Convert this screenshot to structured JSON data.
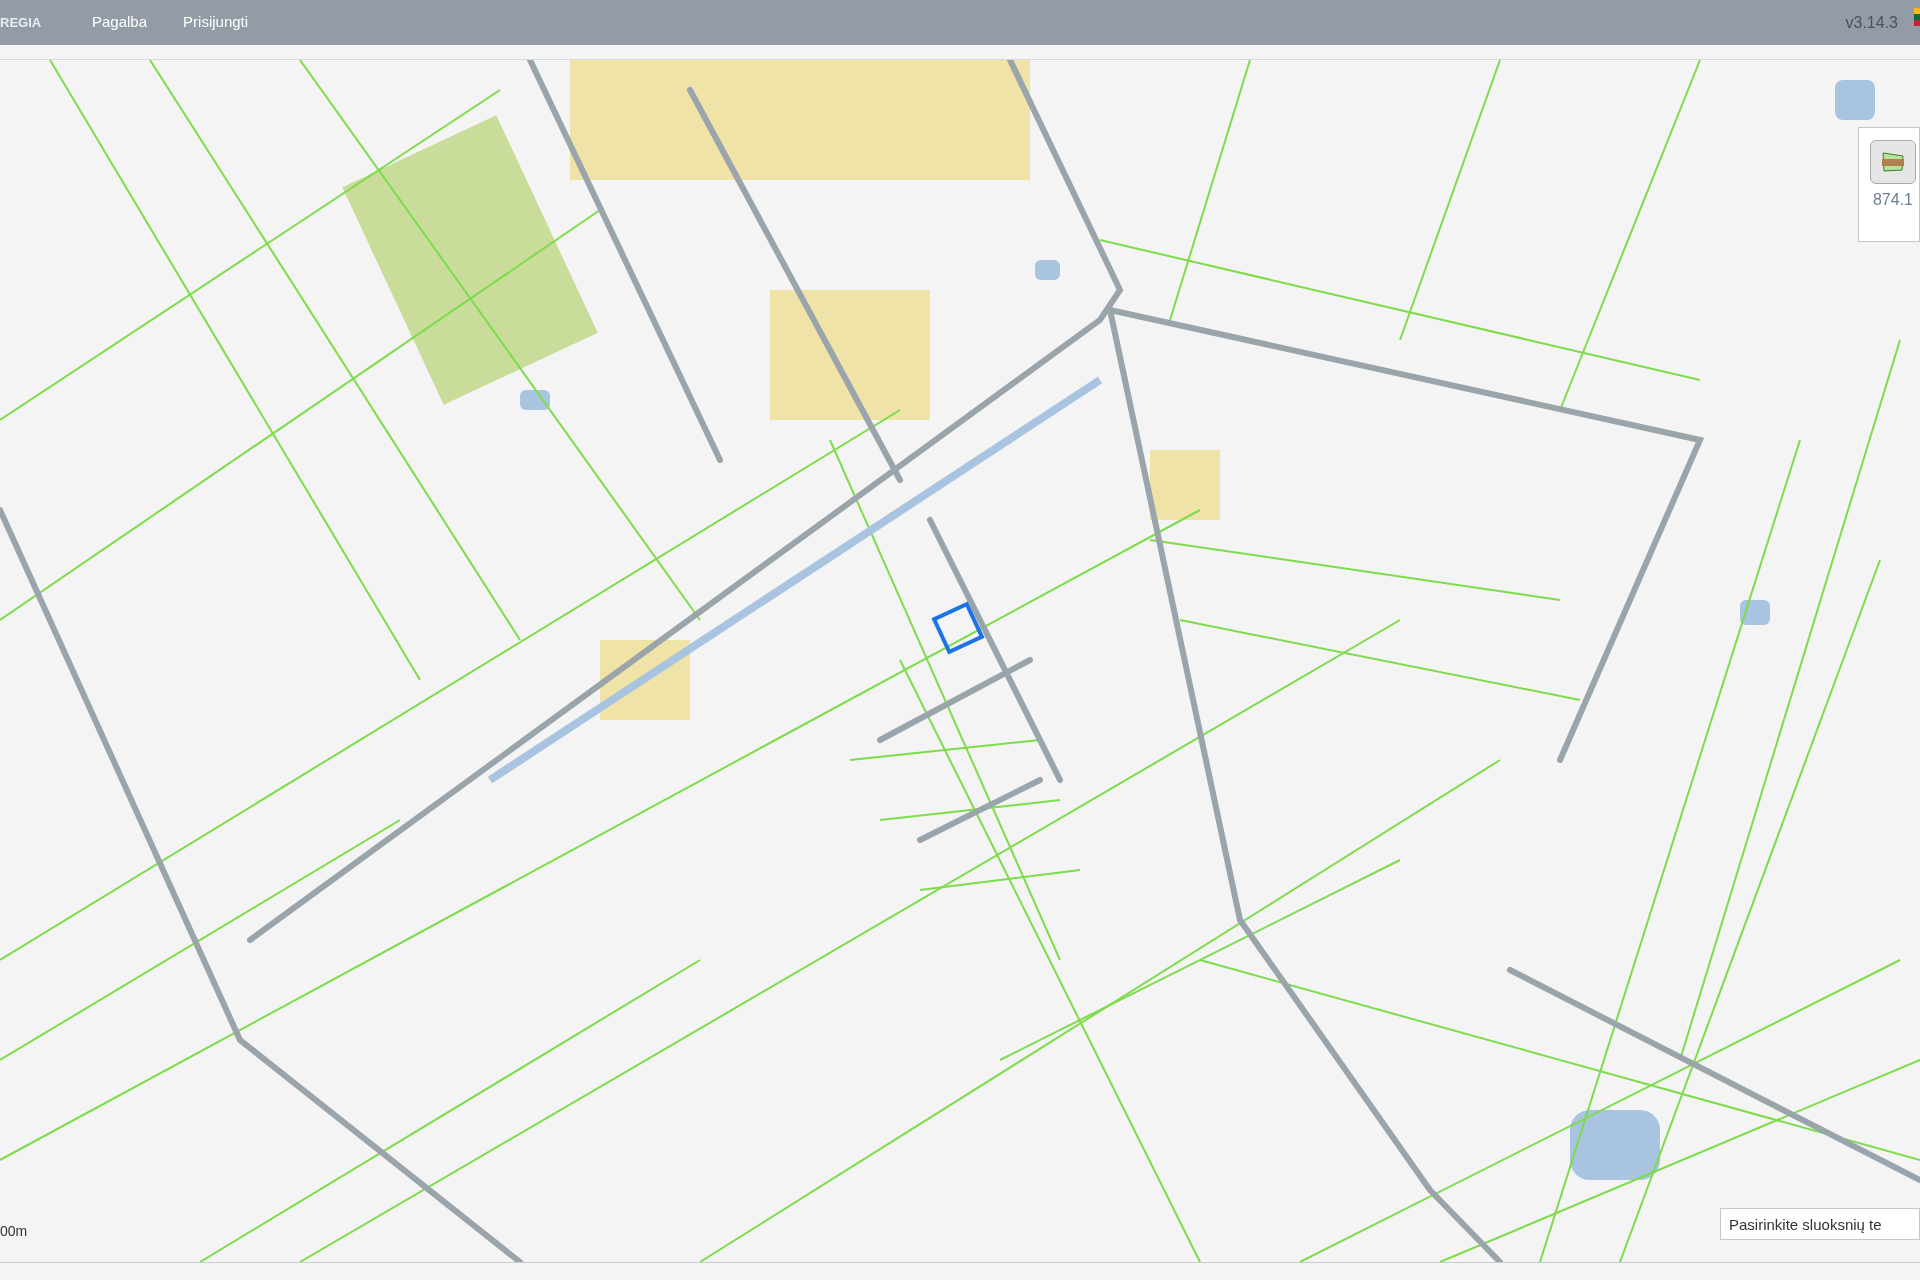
{
  "header": {
    "brand": "REGIA",
    "menu": [
      {
        "label": "Pagalba"
      },
      {
        "label": "Prisijungti"
      }
    ],
    "version": "v3.14.3"
  },
  "measure_tool": {
    "reading": "874.1"
  },
  "map": {
    "scale_label": "00m",
    "layer_search": {
      "placeholder": "Pasirinkite sluoksnių te"
    }
  }
}
